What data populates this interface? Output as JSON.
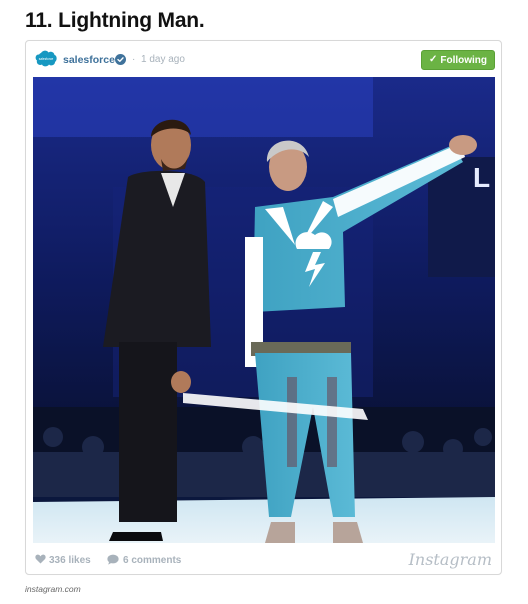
{
  "article": {
    "heading": "11. Lightning Man."
  },
  "embed": {
    "username": "salesforce",
    "separator": "·",
    "timestamp": "1 day ago",
    "follow_button_label": "Following",
    "likes_label": "336 likes",
    "comments_label": "6 comments",
    "brand_wordmark": "Instagram",
    "verified": true,
    "avatar_logo_text": "salesforce",
    "colors": {
      "username": "#3f729b",
      "follow_button": "#6bb344",
      "muted_text": "#a8b2bb",
      "verified_badge": "#3f729b",
      "avatar_cloud": "#1798c1"
    },
    "icons": [
      "salesforce-logo-icon",
      "verified-badge-icon",
      "checkmark-icon",
      "heart-icon",
      "comment-bubble-icon"
    ]
  },
  "credit": {
    "source_text": "instagram.com"
  }
}
